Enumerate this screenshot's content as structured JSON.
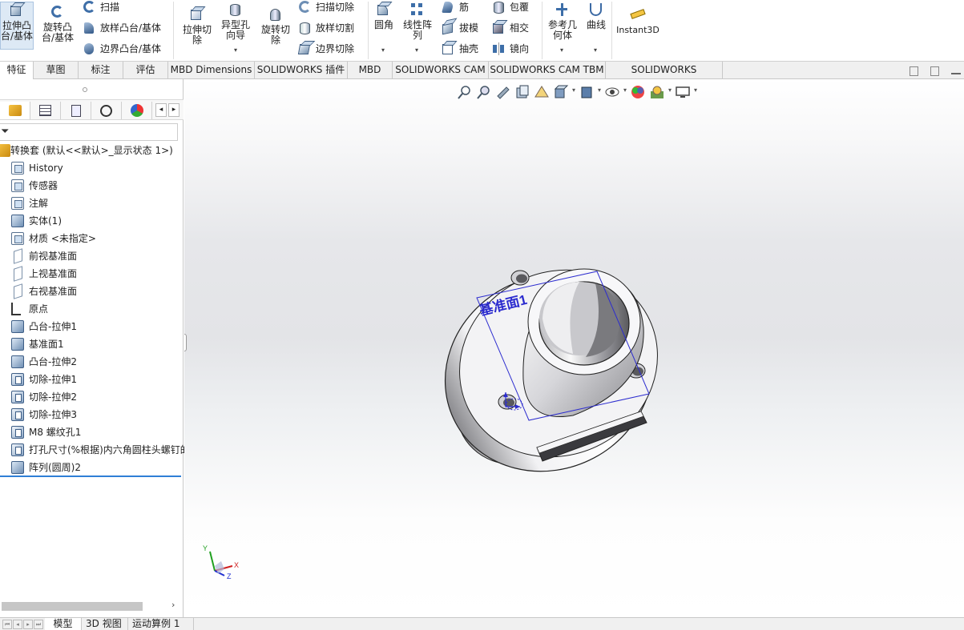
{
  "ribbon": {
    "extrude_boss": "拉伸凸\n台/基体",
    "revolve_boss": "旋转凸\n台/基体",
    "sweep": "扫描",
    "loft_boss": "放样凸台/基体",
    "boundary_boss": "边界凸台/基体",
    "extrude_cut": "拉伸切\n除",
    "hole_wizard": "异型孔\n向导",
    "revolve_cut": "旋转切\n除",
    "sweep_cut": "扫描切除",
    "loft_cut": "放样切割",
    "boundary_cut": "边界切除",
    "fillet": "圆角",
    "linear_pattern": "线性阵\n列",
    "rib": "筋",
    "draft": "拔模",
    "shell": "抽壳",
    "wrap": "包覆",
    "intersect": "相交",
    "mirror": "镜向",
    "reference_geometry": "参考几\n何体",
    "curves": "曲线",
    "instant3d": "Instant3D"
  },
  "command_tabs": [
    "特征",
    "草图",
    "标注",
    "评估",
    "MBD Dimensions",
    "SOLIDWORKS 插件",
    "MBD",
    "SOLIDWORKS CAM",
    "SOLIDWORKS CAM TBM",
    "SOLIDWORKS Inspection"
  ],
  "tree": {
    "root": "转换套  (默认<<默认>_显示状态 1>)",
    "items": [
      {
        "label": "History",
        "icon": "history-folder-icon"
      },
      {
        "label": "传感器",
        "icon": "sensor-icon"
      },
      {
        "label": "注解",
        "icon": "annotation-icon"
      },
      {
        "label": "实体(1)",
        "icon": "solid-body-icon"
      },
      {
        "label": "材质 <未指定>",
        "icon": "material-icon"
      },
      {
        "label": "前视基准面",
        "icon": "plane-icon"
      },
      {
        "label": "上视基准面",
        "icon": "plane-icon"
      },
      {
        "label": "右视基准面",
        "icon": "plane-icon"
      },
      {
        "label": "原点",
        "icon": "origin-icon"
      },
      {
        "label": "凸台-拉伸1",
        "icon": "boss-extrude-icon"
      },
      {
        "label": "基准面1",
        "icon": "plane-feature-icon"
      },
      {
        "label": "凸台-拉伸2",
        "icon": "boss-extrude-icon"
      },
      {
        "label": "切除-拉伸1",
        "icon": "cut-extrude-icon"
      },
      {
        "label": "切除-拉伸2",
        "icon": "cut-extrude-icon"
      },
      {
        "label": "切除-拉伸3",
        "icon": "cut-extrude-icon"
      },
      {
        "label": "M8 螺纹孔1",
        "icon": "thread-hole-icon"
      },
      {
        "label": "打孔尺寸(%根据)内六角圆柱头螺钉的",
        "icon": "hole-wizard-icon"
      },
      {
        "label": "阵列(圆周)2",
        "icon": "circular-pattern-icon"
      }
    ]
  },
  "viewport": {
    "plane_label": "基准面1",
    "triad": {
      "x": "X",
      "y": "Y",
      "z": "Z"
    }
  },
  "bottom_tabs": [
    "模型",
    "3D 视图",
    "运动算例 1"
  ],
  "colors": {
    "accent": "#2f7fd6",
    "plane": "#2c2ccf",
    "triad_x": "#d02020",
    "triad_y": "#20a020",
    "triad_z": "#2030d0"
  }
}
